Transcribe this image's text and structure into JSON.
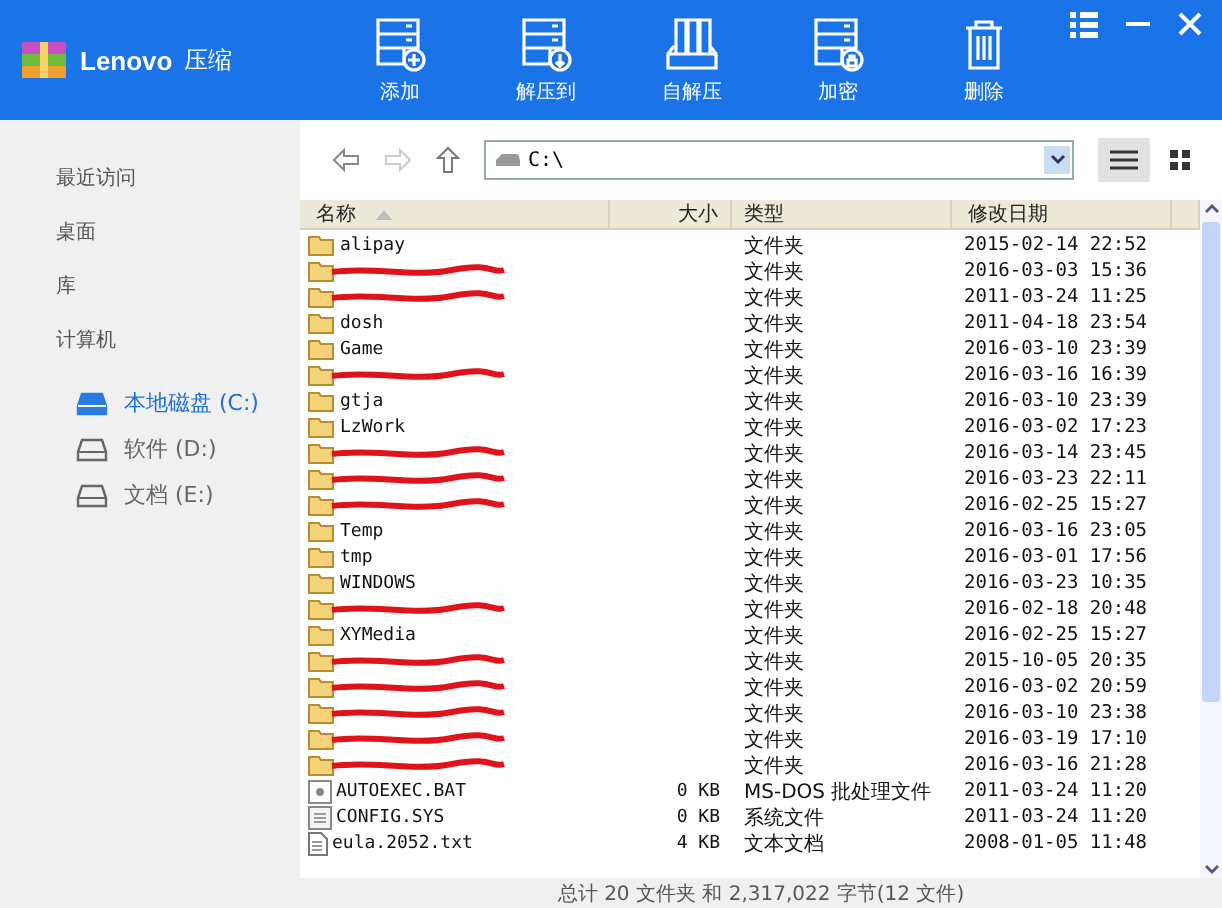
{
  "app": {
    "name": "Lenovo",
    "subtitle": "压缩"
  },
  "toolbar": [
    {
      "label": "添加",
      "kind": "add"
    },
    {
      "label": "解压到",
      "kind": "extract"
    },
    {
      "label": "自解压",
      "kind": "sfx"
    },
    {
      "label": "加密",
      "kind": "lock"
    },
    {
      "label": "删除",
      "kind": "delete"
    }
  ],
  "sidebar": {
    "items": [
      {
        "label": "最近访问",
        "selected": false
      },
      {
        "label": "桌面",
        "selected": false
      },
      {
        "label": "库",
        "selected": false
      },
      {
        "label": "计算机",
        "selected": false,
        "children": [
          {
            "label": "本地磁盘 (C:)",
            "selected": true
          },
          {
            "label": "软件 (D:)",
            "selected": false
          },
          {
            "label": "文档 (E:)",
            "selected": false
          }
        ]
      }
    ]
  },
  "address": {
    "value": "C:\\"
  },
  "view_buttons": [
    {
      "kind": "list",
      "selected": true
    },
    {
      "kind": "grid",
      "selected": false
    }
  ],
  "table": {
    "columns": [
      "名称",
      "大小",
      "类型",
      "修改日期"
    ],
    "rows": [
      {
        "kind": "folder",
        "name": "alipay",
        "size": "",
        "type": "文件夹",
        "date": "2015-02-14 22:52"
      },
      {
        "kind": "folder",
        "redacted": true,
        "type": "文件夹",
        "date": "2016-03-03 15:36"
      },
      {
        "kind": "folder",
        "redacted": true,
        "type": "文件夹",
        "date": "2011-03-24 11:25"
      },
      {
        "kind": "folder",
        "name": "dosh",
        "type": "文件夹",
        "date": "2011-04-18 23:54"
      },
      {
        "kind": "folder",
        "name": "Game",
        "type": "文件夹",
        "date": "2016-03-10 23:39"
      },
      {
        "kind": "folder",
        "redacted": true,
        "type": "文件夹",
        "date": "2016-03-16 16:39"
      },
      {
        "kind": "folder",
        "name": "gtja",
        "type": "文件夹",
        "date": "2016-03-10 23:39"
      },
      {
        "kind": "folder",
        "name": "LzWork",
        "type": "文件夹",
        "date": "2016-03-02 17:23"
      },
      {
        "kind": "folder",
        "redacted": true,
        "type": "文件夹",
        "date": "2016-03-14 23:45"
      },
      {
        "kind": "folder",
        "redacted": true,
        "type": "文件夹",
        "date": "2016-03-23 22:11"
      },
      {
        "kind": "folder",
        "redacted": true,
        "type": "文件夹",
        "date": "2016-02-25 15:27"
      },
      {
        "kind": "folder",
        "name": "Temp",
        "type": "文件夹",
        "date": "2016-03-16 23:05"
      },
      {
        "kind": "folder",
        "name": "tmp",
        "type": "文件夹",
        "date": "2016-03-01 17:56"
      },
      {
        "kind": "folder",
        "name": "WINDOWS",
        "type": "文件夹",
        "date": "2016-03-23 10:35"
      },
      {
        "kind": "folder",
        "redacted": true,
        "type": "文件夹",
        "date": "2016-02-18 20:48"
      },
      {
        "kind": "folder",
        "name": "XYMedia",
        "type": "文件夹",
        "date": "2016-02-25 15:27"
      },
      {
        "kind": "folder",
        "redacted": true,
        "type": "文件夹",
        "date": "2015-10-05 20:35"
      },
      {
        "kind": "folder",
        "redacted": true,
        "type": "文件夹",
        "date": "2016-03-02 20:59"
      },
      {
        "kind": "folder",
        "redacted": true,
        "type": "文件夹",
        "date": "2016-03-10 23:38"
      },
      {
        "kind": "folder",
        "redacted": true,
        "type": "文件夹",
        "date": "2016-03-19 17:10"
      },
      {
        "kind": "folder",
        "redacted": true,
        "type": "文件夹",
        "date": "2016-03-16 21:28"
      },
      {
        "kind": "batch",
        "name": "AUTOEXEC.BAT",
        "size": "0 KB",
        "type": "MS-DOS 批处理文件",
        "date": "2011-03-24 11:20"
      },
      {
        "kind": "system",
        "name": "CONFIG.SYS",
        "size": "0 KB",
        "type": "系统文件",
        "date": "2011-03-24 11:20"
      },
      {
        "kind": "text",
        "name": "eula.2052.txt",
        "size": "4 KB",
        "type": "文本文档",
        "date": "2008-01-05 11:48"
      }
    ]
  },
  "status_bar": "总计 20 文件夹 和 2,317,022 字节(12 文件)"
}
